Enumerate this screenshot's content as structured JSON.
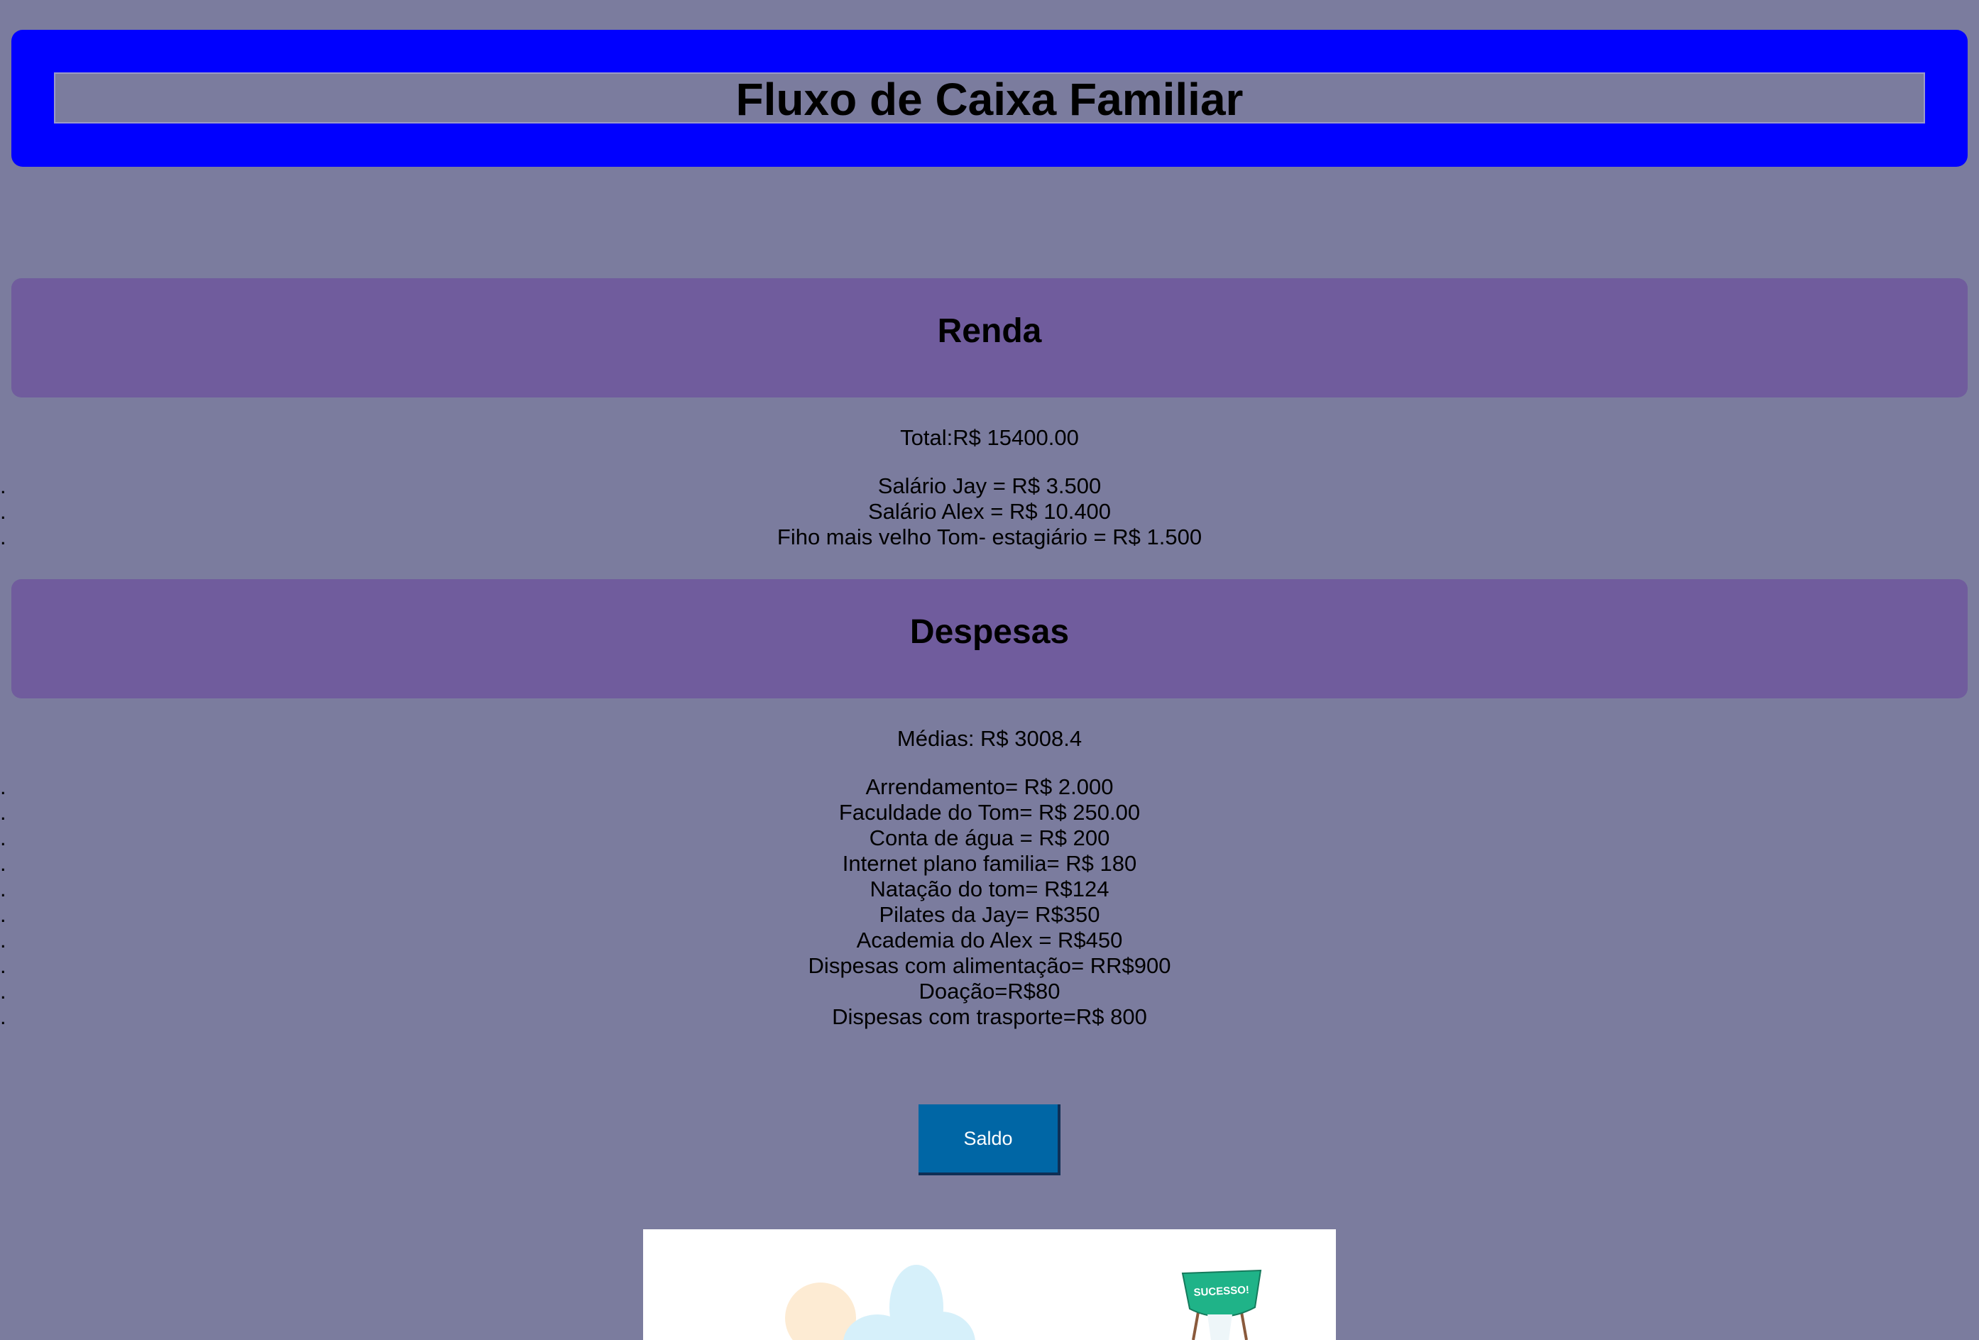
{
  "header": {
    "title": "Fluxo de Caixa Familiar"
  },
  "renda": {
    "heading": "Renda",
    "total": "Total:R$ 15400.00",
    "items": [
      "Salário Jay = R$ 3.500",
      "Salário Alex = R$ 10.400",
      "Fiho mais velho Tom- estagiário = R$ 1.500"
    ]
  },
  "despesas": {
    "heading": "Despesas",
    "media": "Médias: R$ 3008.4",
    "items": [
      "Arrendamento= R$ 2.000",
      "Faculdade do Tom= R$ 250.00",
      "Conta de água = R$ 200",
      "Internet plano familia= R$ 180",
      "Natação do tom= R$124",
      "Pilates da Jay= R$350",
      "Academia do Alex = R$450",
      "Dispesas com alimentação= RR$900",
      "Doação=R$80",
      "Dispesas com trasporte=R$ 800"
    ]
  },
  "saldo_button": {
    "label": "Saldo"
  },
  "illustration": {
    "banner_text": "SUCESSO!"
  },
  "colors": {
    "page_bg": "#7b7c9e",
    "header_bg": "#0000ff",
    "section_bg": "#705c9d",
    "button_bg": "#0066a5",
    "banner_green": "#1fb388"
  },
  "list_marker": "."
}
